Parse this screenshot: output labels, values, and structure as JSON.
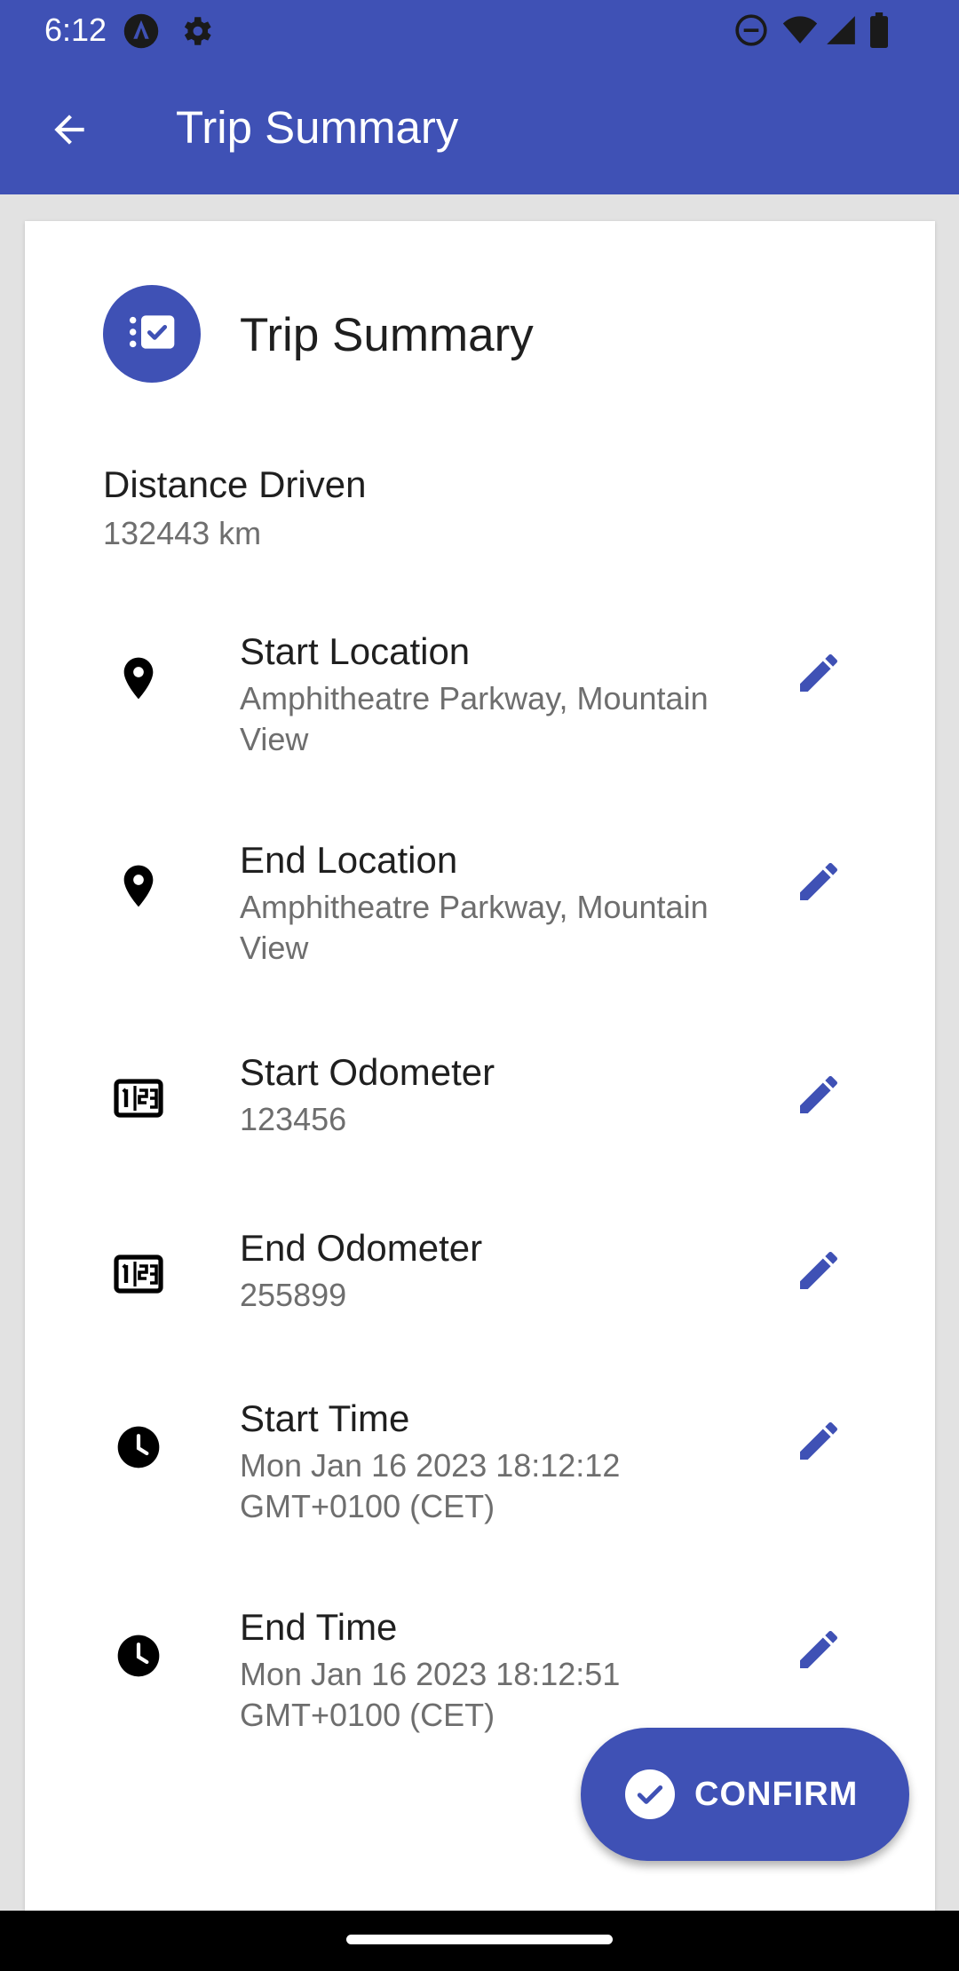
{
  "status_bar": {
    "time": "6:12",
    "icons_left": [
      "android-auto-icon",
      "settings-icon"
    ],
    "icons_right": [
      "do-not-disturb-icon",
      "wifi-icon",
      "signal-icon",
      "battery-icon"
    ]
  },
  "app_bar": {
    "title": "Trip Summary",
    "back_icon": "arrow-back-icon",
    "color": "#3f51b5"
  },
  "card": {
    "header_icon": "trip-checklist-icon",
    "title": "Trip Summary",
    "distance": {
      "label": "Distance Driven",
      "value": "132443 km"
    },
    "rows": [
      {
        "label": "Start Location",
        "value": "Amphitheatre Parkway, Mountain View",
        "icon": "location-pin-icon"
      },
      {
        "label": "End Location",
        "value": "Amphitheatre Parkway, Mountain View",
        "icon": "location-pin-icon"
      },
      {
        "label": "Start Odometer",
        "value": "123456",
        "icon": "odometer-icon"
      },
      {
        "label": "End Odometer",
        "value": "255899",
        "icon": "odometer-icon"
      },
      {
        "label": "Start Time",
        "value": "Mon Jan 16 2023 18:12:12 GMT+0100 (CET)",
        "icon": "clock-icon"
      },
      {
        "label": "End Time",
        "value": "Mon Jan 16 2023 18:12:51 GMT+0100 (CET)",
        "icon": "clock-icon"
      }
    ]
  },
  "confirm_button": {
    "label": "CONFIRM",
    "icon": "check-circle-icon"
  },
  "colors": {
    "primary": "#3f51b5",
    "text_primary": "#1f1f1f",
    "text_secondary": "#6e6e6e"
  }
}
